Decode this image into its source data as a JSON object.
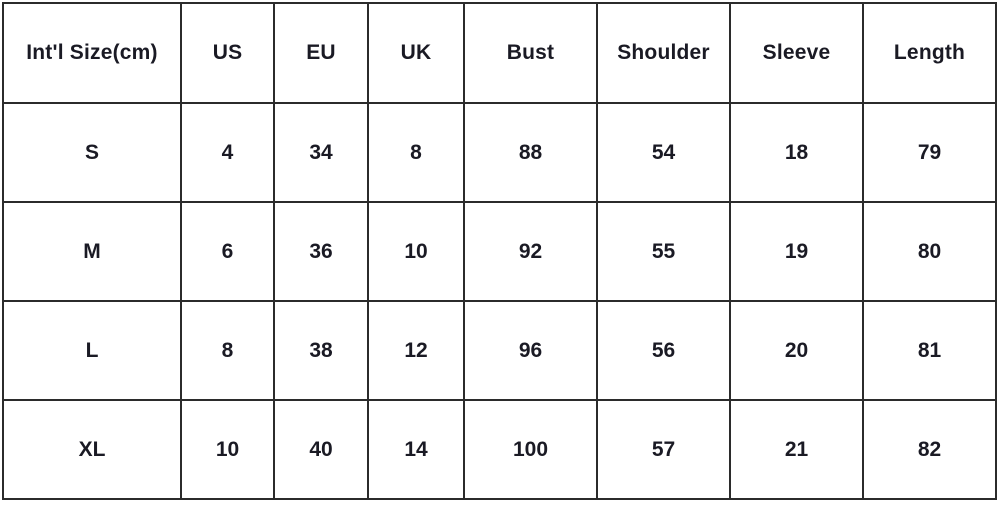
{
  "table": {
    "headers": [
      "Int'l Size(cm)",
      "US",
      "EU",
      "UK",
      "Bust",
      "Shoulder",
      "Sleeve",
      "Length"
    ],
    "rows": [
      {
        "size": "S",
        "us": "4",
        "eu": "34",
        "uk": "8",
        "bust": "88",
        "shoulder": "54",
        "sleeve": "18",
        "length": "79"
      },
      {
        "size": "M",
        "us": "6",
        "eu": "36",
        "uk": "10",
        "bust": "92",
        "shoulder": "55",
        "sleeve": "19",
        "length": "80"
      },
      {
        "size": "L",
        "us": "8",
        "eu": "38",
        "uk": "12",
        "bust": "96",
        "shoulder": "56",
        "sleeve": "20",
        "length": "81"
      },
      {
        "size": "XL",
        "us": "10",
        "eu": "40",
        "uk": "14",
        "bust": "100",
        "shoulder": "57",
        "sleeve": "21",
        "length": "82"
      }
    ]
  },
  "colors": {
    "header_background": "#c7c096",
    "size_column_background": "#f8c294",
    "region_columns_background": "#8fb4e4",
    "measurement_columns_background": "#ffffff",
    "border": "#2b2b2b",
    "text": "#1a1a24"
  }
}
